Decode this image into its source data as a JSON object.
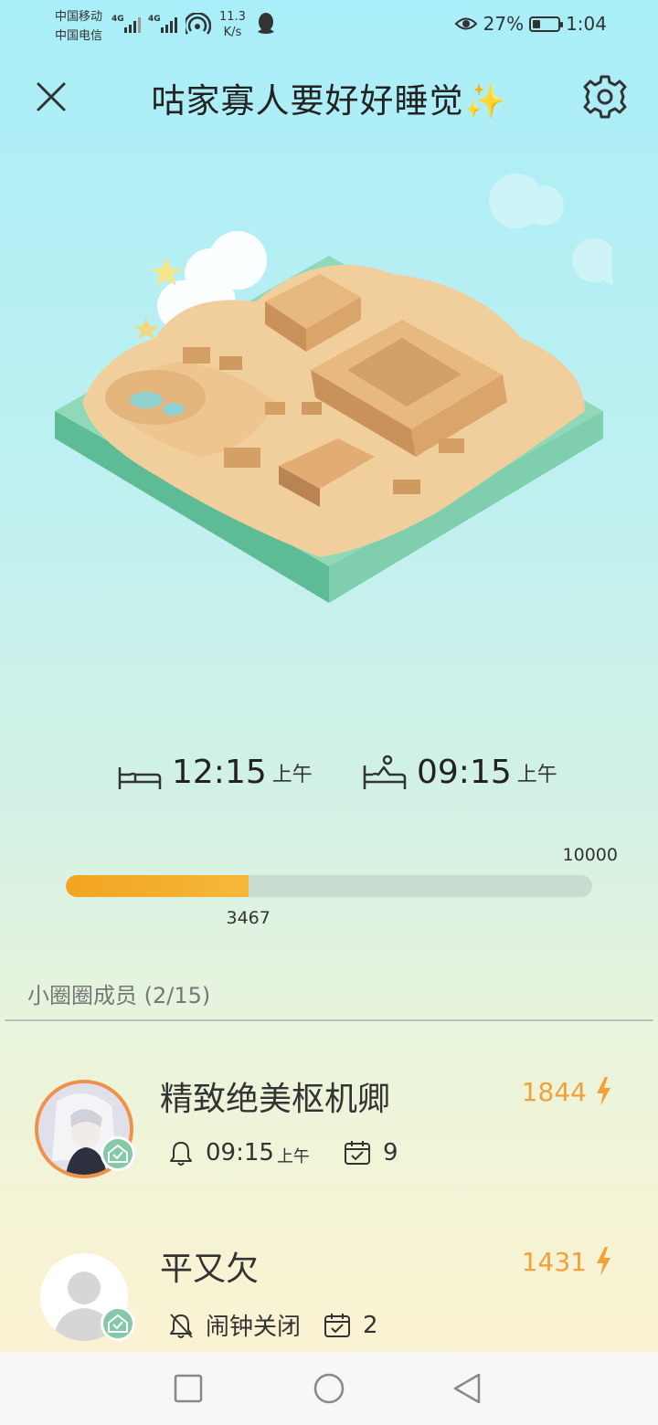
{
  "status_bar": {
    "carrier_1": "中国移动",
    "carrier_2": "中国电信",
    "net_speed_value": "11.3",
    "net_speed_unit": "K/s",
    "battery_percent": "27%",
    "time": "1:04",
    "icons": [
      "signal-4g-icon",
      "wifi-hotspot-icon",
      "qq-penguin-icon",
      "eye-comfort-icon",
      "battery-icon"
    ]
  },
  "header": {
    "title": "咕家寡人要好好睡觉✨",
    "close_icon": "close-icon",
    "settings_icon": "gear-icon"
  },
  "sleep": {
    "bedtime": "12:15",
    "bedtime_period": "上午",
    "wake_time": "09:15",
    "wake_period": "上午"
  },
  "progress": {
    "max_label": "10000",
    "current_label": "3467",
    "fraction": 0.3467,
    "fill_color": "#f2a421",
    "track_color": "#c8ddd0"
  },
  "members": {
    "title": "小圈圈成员 (2/15)",
    "items": [
      {
        "name": "精致绝美枢机卿",
        "score": "1844",
        "alarm": "09:15",
        "alarm_period": "上午",
        "days": "9"
      },
      {
        "name": "平又欠",
        "score": "1431",
        "alarm": "闹钟关闭",
        "days": "2"
      }
    ]
  },
  "colors": {
    "accent_orange": "#f2a03a",
    "badge_green": "#86c9a8",
    "island_green": "#6cc9a3",
    "sand": "#f1cf9c"
  },
  "nav": [
    "recent-apps-icon",
    "home-icon",
    "back-icon"
  ]
}
